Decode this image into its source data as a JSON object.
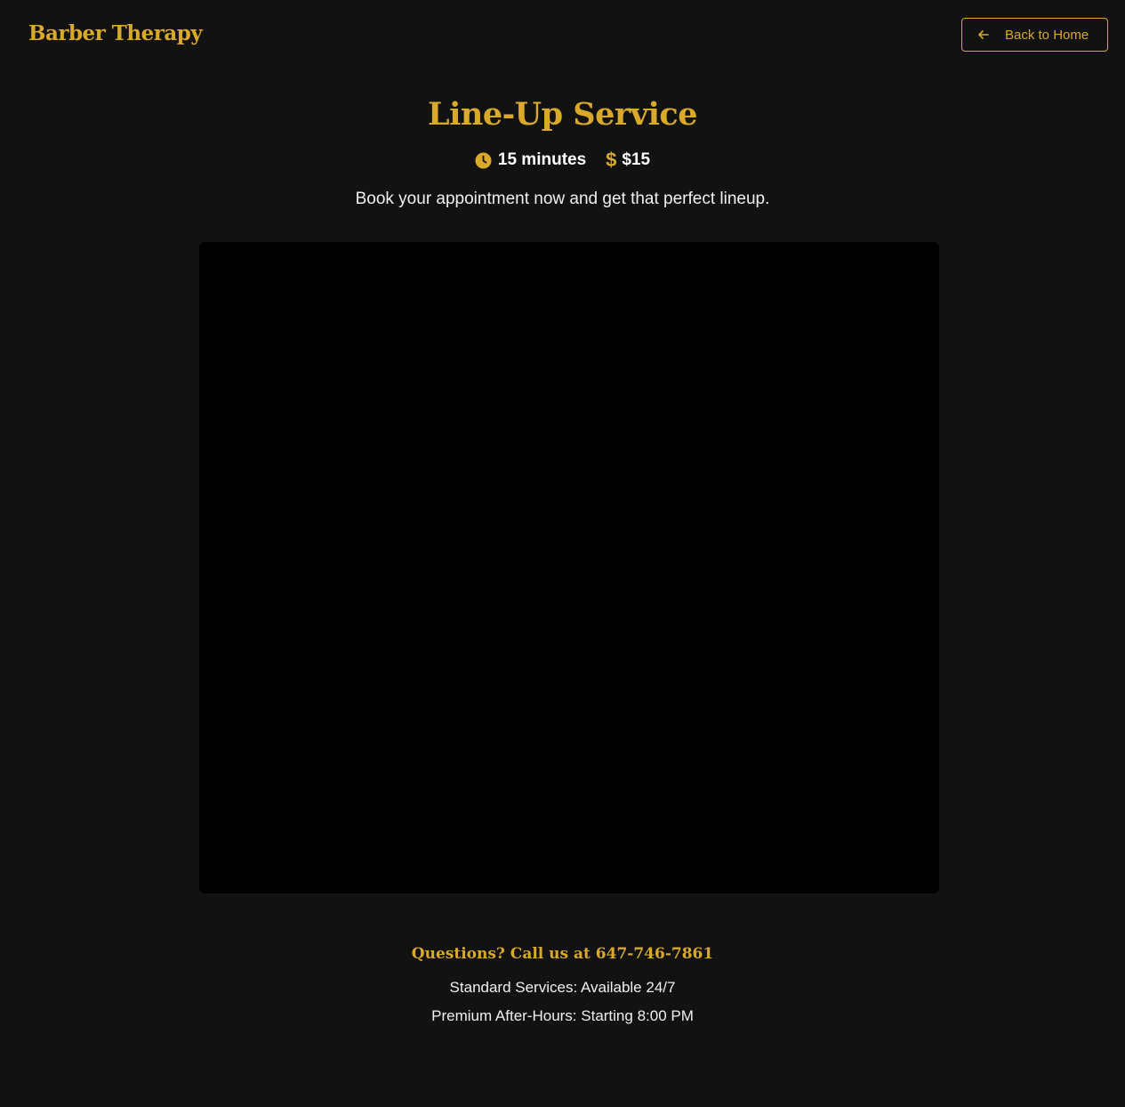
{
  "brand": "Barber Therapy",
  "nav": {
    "back_label": "Back to Home"
  },
  "service": {
    "title": "Line-Up Service",
    "duration": "15 minutes",
    "price": "$15",
    "price_symbol": "$",
    "price_value": "$15",
    "tagline": "Book your appointment now and get that perfect lineup."
  },
  "footer": {
    "contact": "Questions? Call us at 647-746-7861",
    "standard_hours": "Standard Services: Available 24/7",
    "premium_hours": "Premium After-Hours: Starting 8:00 PM"
  },
  "colors": {
    "background": "#121212",
    "accent": "#d9a92a",
    "frame": "#000000"
  },
  "icons": {
    "back": "arrow-left-icon",
    "duration": "clock-icon",
    "price": "dollar-icon"
  }
}
